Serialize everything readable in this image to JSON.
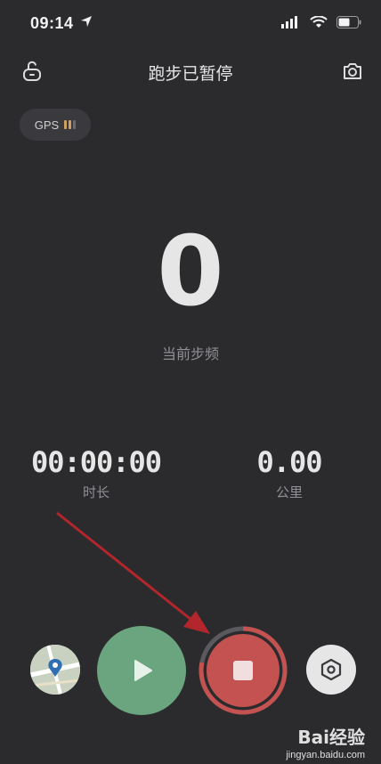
{
  "status_bar": {
    "time": "09:14",
    "icons": [
      "location-arrow-icon",
      "cellular-signal-icon",
      "wifi-icon",
      "battery-icon"
    ]
  },
  "header": {
    "title": "跑步已暂停",
    "left_icon": "unlock-icon",
    "right_icon": "camera-icon"
  },
  "gps": {
    "label": "GPS",
    "signal_color": "#d0a063"
  },
  "metrics": {
    "cadence_value": "0",
    "cadence_label": "当前步频",
    "duration_value": "00:00:00",
    "duration_label": "时长",
    "distance_value": "0.00",
    "distance_label": "公里"
  },
  "controls": {
    "map_icon": "map-icon",
    "resume_icon": "play-icon",
    "stop_icon": "stop-icon",
    "settings_icon": "settings-hexagon-icon",
    "resume_color": "#6aa57f",
    "stop_color": "#c45250"
  },
  "annotation": {
    "arrow_color": "#b3262b"
  },
  "watermark": {
    "main": "Bai经验",
    "sub": "jingyan.baidu.com"
  }
}
